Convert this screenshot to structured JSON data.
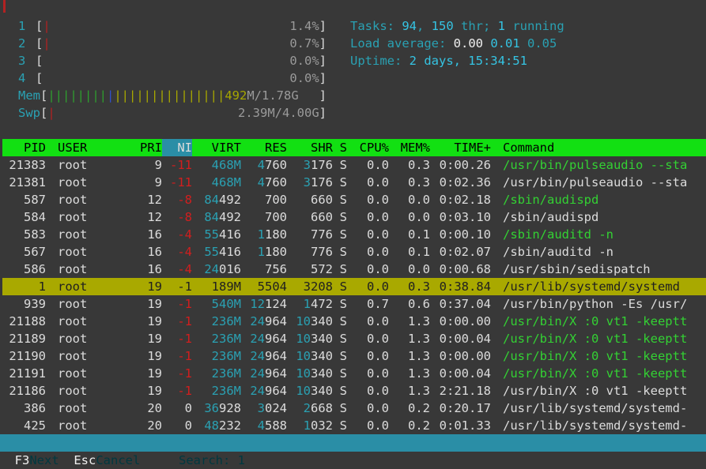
{
  "meters": {
    "cpu": [
      {
        "id": "1",
        "percent": "1.4%",
        "usage": 0.014
      },
      {
        "id": "2",
        "percent": "0.7%",
        "usage": 0.007
      },
      {
        "id": "3",
        "percent": "0.0%",
        "usage": 0.0
      },
      {
        "id": "4",
        "percent": "0.0%",
        "usage": 0.0
      }
    ],
    "mem": {
      "label": "Mem",
      "bars_green": "||||||||",
      "bars_blue": "|",
      "bars_yellow": "|||||||||||||||",
      "text_a": "492",
      "text_b": "M/1.78G"
    },
    "swp": {
      "label": "Swp",
      "bars_red": "|",
      "text": "2.39M/4.00G"
    }
  },
  "info": {
    "tasks_label": "Tasks: ",
    "tasks": "94",
    "sep1": ", ",
    "threads": "150",
    "thr_label": " thr; ",
    "running": "1",
    "running_label": " running",
    "load_label": "Load average: ",
    "load1": "0.00",
    "load5": "0.01",
    "load15": "0.05",
    "uptime_label": "Uptime: ",
    "uptime": "2 days, 15:34:51"
  },
  "table": {
    "headers": [
      "PID",
      "USER",
      "PRI",
      "NI",
      "VIRT",
      "RES",
      "SHR",
      "S",
      "CPU%",
      "MEM%",
      "TIME+",
      "Command"
    ],
    "rows": [
      {
        "pid": "21383",
        "user": "root",
        "pri": "9",
        "ni": "-11",
        "virt": "468M",
        "res_a": "4",
        "res_b": "760",
        "shr_a": "3",
        "shr_b": "176",
        "s": "S",
        "cpu": "0.0",
        "mem": "0.3",
        "time": "0:00.26",
        "cmd": "/usr/bin/pulseaudio --sta",
        "virtc": true,
        "cmdc": true
      },
      {
        "pid": "21381",
        "user": "root",
        "pri": "9",
        "ni": "-11",
        "virt": "468M",
        "res_a": "4",
        "res_b": "760",
        "shr_a": "3",
        "shr_b": "176",
        "s": "S",
        "cpu": "0.0",
        "mem": "0.3",
        "time": "0:02.36",
        "cmd": "/usr/bin/pulseaudio --sta",
        "virtc": true,
        "cmdc": false
      },
      {
        "pid": "587",
        "user": "root",
        "pri": "12",
        "ni": "-8",
        "virt_a": "84",
        "virt_b": "492",
        "res": "700",
        "shr": "660",
        "s": "S",
        "cpu": "0.0",
        "mem": "0.0",
        "time": "0:02.18",
        "cmd": "/sbin/audispd",
        "cmdc": true
      },
      {
        "pid": "584",
        "user": "root",
        "pri": "12",
        "ni": "-8",
        "virt_a": "84",
        "virt_b": "492",
        "res": "700",
        "shr": "660",
        "s": "S",
        "cpu": "0.0",
        "mem": "0.0",
        "time": "0:03.10",
        "cmd": "/sbin/audispd",
        "cmdc": false
      },
      {
        "pid": "583",
        "user": "root",
        "pri": "16",
        "ni": "-4",
        "virt_a": "55",
        "virt_b": "416",
        "res_a": "1",
        "res_b": "180",
        "shr": "776",
        "s": "S",
        "cpu": "0.0",
        "mem": "0.1",
        "time": "0:00.10",
        "cmd": "/sbin/auditd -n",
        "cmdc": true
      },
      {
        "pid": "567",
        "user": "root",
        "pri": "16",
        "ni": "-4",
        "virt_a": "55",
        "virt_b": "416",
        "res_a": "1",
        "res_b": "180",
        "shr": "776",
        "s": "S",
        "cpu": "0.0",
        "mem": "0.1",
        "time": "0:02.07",
        "cmd": "/sbin/auditd -n",
        "cmdc": false
      },
      {
        "pid": "586",
        "user": "root",
        "pri": "16",
        "ni": "-4",
        "virt_a": "24",
        "virt_b": "016",
        "res": "756",
        "shr": "572",
        "s": "S",
        "cpu": "0.0",
        "mem": "0.0",
        "time": "0:00.68",
        "cmd": "/usr/sbin/sedispatch",
        "cmdc": false
      },
      {
        "pid": "1",
        "user": "root",
        "pri": "19",
        "ni": "-1",
        "virt": "189M",
        "res": "5504",
        "shr": "3208",
        "s": "S",
        "cpu": "0.0",
        "mem": "0.3",
        "time": "0:38.84",
        "cmd": "/usr/lib/systemd/systemd",
        "sel": true
      },
      {
        "pid": "939",
        "user": "root",
        "pri": "19",
        "ni": "-1",
        "virt": "540M",
        "res_a": "12",
        "res_b": "124",
        "shr_a": "1",
        "shr_b": "472",
        "s": "S",
        "cpu": "0.7",
        "mem": "0.6",
        "time": "0:37.04",
        "cmd": "/usr/bin/python -Es /usr/",
        "virtc": true,
        "cmdc": false
      },
      {
        "pid": "21188",
        "user": "root",
        "pri": "19",
        "ni": "-1",
        "virt": "236M",
        "res_a": "24",
        "res_b": "964",
        "shr_a": "10",
        "shr_b": "340",
        "s": "S",
        "cpu": "0.0",
        "mem": "1.3",
        "time": "0:00.00",
        "cmd": "/usr/bin/X :0 vt1 -keeptt",
        "virtc": true,
        "cmdc": true
      },
      {
        "pid": "21189",
        "user": "root",
        "pri": "19",
        "ni": "-1",
        "virt": "236M",
        "res_a": "24",
        "res_b": "964",
        "shr_a": "10",
        "shr_b": "340",
        "s": "S",
        "cpu": "0.0",
        "mem": "1.3",
        "time": "0:00.04",
        "cmd": "/usr/bin/X :0 vt1 -keeptt",
        "virtc": true,
        "cmdc": true
      },
      {
        "pid": "21190",
        "user": "root",
        "pri": "19",
        "ni": "-1",
        "virt": "236M",
        "res_a": "24",
        "res_b": "964",
        "shr_a": "10",
        "shr_b": "340",
        "s": "S",
        "cpu": "0.0",
        "mem": "1.3",
        "time": "0:00.00",
        "cmd": "/usr/bin/X :0 vt1 -keeptt",
        "virtc": true,
        "cmdc": true
      },
      {
        "pid": "21191",
        "user": "root",
        "pri": "19",
        "ni": "-1",
        "virt": "236M",
        "res_a": "24",
        "res_b": "964",
        "shr_a": "10",
        "shr_b": "340",
        "s": "S",
        "cpu": "0.0",
        "mem": "1.3",
        "time": "0:00.04",
        "cmd": "/usr/bin/X :0 vt1 -keeptt",
        "virtc": true,
        "cmdc": true
      },
      {
        "pid": "21186",
        "user": "root",
        "pri": "19",
        "ni": "-1",
        "virt": "236M",
        "res_a": "24",
        "res_b": "964",
        "shr_a": "10",
        "shr_b": "340",
        "s": "S",
        "cpu": "0.0",
        "mem": "1.3",
        "time": "2:21.18",
        "cmd": "/usr/bin/X :0 vt1 -keeptt",
        "virtc": true,
        "cmdc": false
      },
      {
        "pid": "386",
        "user": "root",
        "pri": "20",
        "ni": "0",
        "virt_a": "36",
        "virt_b": "928",
        "res_a": "3",
        "res_b": "024",
        "shr_a": "2",
        "shr_b": "668",
        "s": "S",
        "cpu": "0.0",
        "mem": "0.2",
        "time": "0:20.17",
        "cmd": "/usr/lib/systemd/systemd-",
        "cmdc": false
      },
      {
        "pid": "425",
        "user": "root",
        "pri": "20",
        "ni": "0",
        "virt_a": "48",
        "virt_b": "232",
        "res_a": "4",
        "res_b": "588",
        "shr_a": "1",
        "shr_b": "032",
        "s": "S",
        "cpu": "0.0",
        "mem": "0.2",
        "time": "0:01.33",
        "cmd": "/usr/lib/systemd/systemd-",
        "cmdc": false
      }
    ]
  },
  "footer": {
    "key1": "F3",
    "label1": "Next  ",
    "key2": "Esc",
    "label2": "Cancel  ",
    "search_label": "Search: ",
    "search_value": "1"
  },
  "colors": {
    "background": "#383838",
    "header_bg": "#12e012",
    "sort_column_bg": "#2a8ea6",
    "selected_row_bg": "#a9a900",
    "footer_bg": "#2a8ea6"
  }
}
